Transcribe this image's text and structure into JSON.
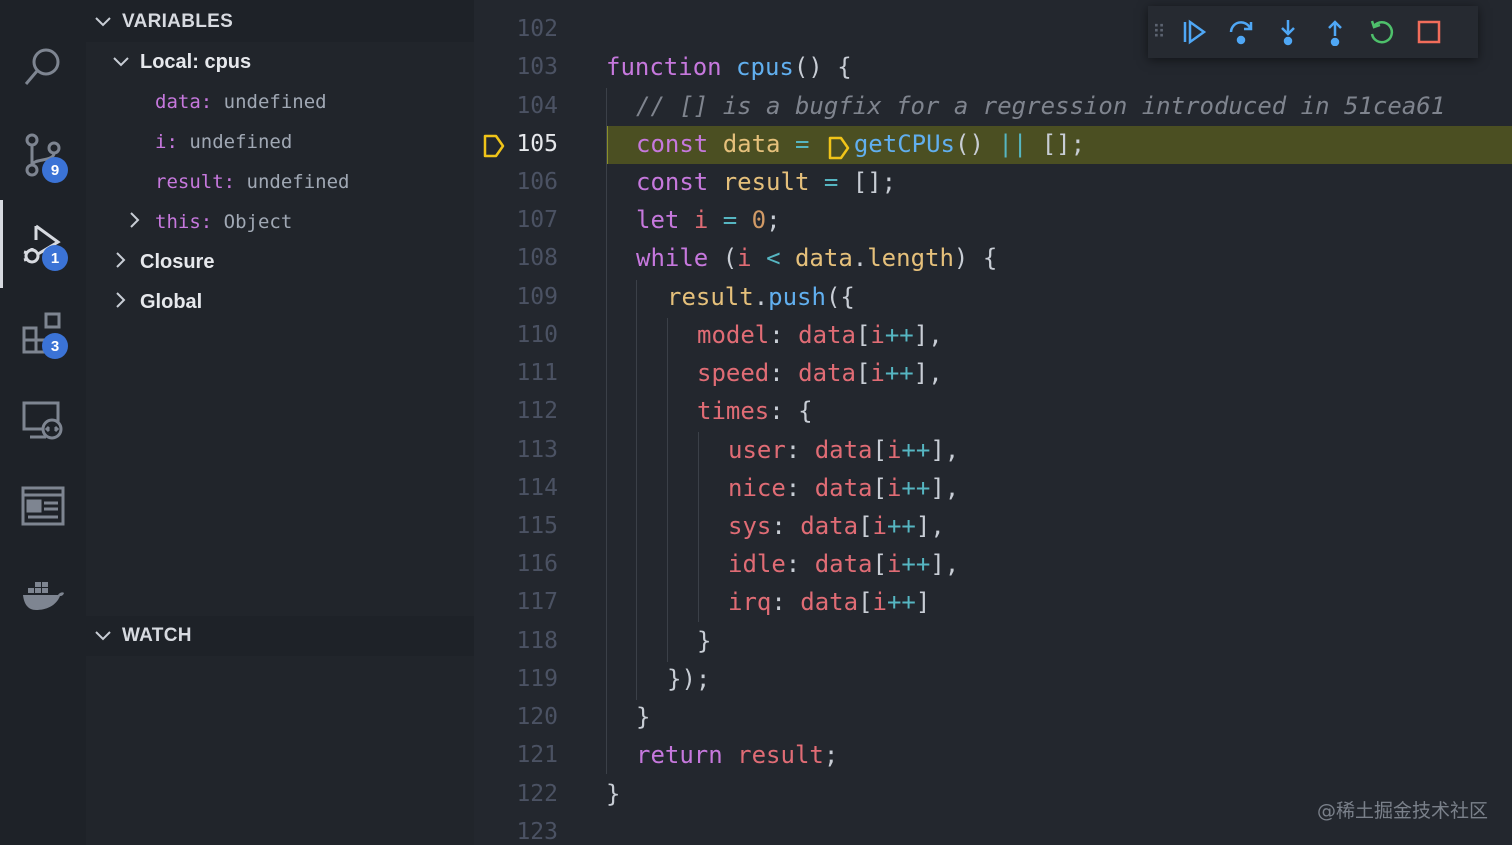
{
  "activity_bar": {
    "items": [
      {
        "icon": "search-icon"
      },
      {
        "icon": "source-control-icon",
        "badge": "9"
      },
      {
        "icon": "run-and-debug-icon",
        "badge": "1"
      },
      {
        "icon": "extensions-icon",
        "badge": "3"
      },
      {
        "icon": "remote-explorer-icon"
      },
      {
        "icon": "browser-preview-icon"
      },
      {
        "icon": "docker-icon"
      }
    ]
  },
  "sidebar": {
    "variables": {
      "title": "VARIABLES",
      "local_scope": "Local: cpus",
      "vars": [
        {
          "name": "data",
          "value": "undefined"
        },
        {
          "name": "i",
          "value": "undefined"
        },
        {
          "name": "result",
          "value": "undefined"
        },
        {
          "name": "this",
          "value": "Object"
        }
      ],
      "closure": "Closure",
      "global": "Global"
    },
    "watch": {
      "title": "WATCH"
    }
  },
  "editor": {
    "line_numbers": [
      "102",
      "103",
      "104",
      "105",
      "106",
      "107",
      "108",
      "109",
      "110",
      "111",
      "112",
      "113",
      "114",
      "115",
      "116",
      "117",
      "118",
      "119",
      "120",
      "121",
      "122",
      "123"
    ],
    "current_line": "105",
    "code": {
      "l103": [
        "function",
        "cpus",
        "() {"
      ],
      "l104": "// [] is a bugfix for a regression introduced in 51cea61",
      "l105": [
        "const",
        "data",
        "=",
        "getCPUs",
        "()",
        "||",
        "[];"
      ],
      "l106": [
        "const",
        "result",
        "=",
        "[];"
      ],
      "l107": [
        "let",
        "i",
        "=",
        "0",
        ";"
      ],
      "l108": [
        "while",
        "(",
        "i",
        "<",
        "data",
        ".",
        "length",
        ") {"
      ],
      "l109": [
        "result",
        ".",
        "push",
        "({"
      ],
      "l110": [
        "model",
        ": ",
        "data",
        "[",
        "i",
        "++",
        "],"
      ],
      "l111": [
        "speed",
        ": ",
        "data",
        "[",
        "i",
        "++",
        "],"
      ],
      "l112": [
        "times",
        ": {"
      ],
      "l113": [
        "user",
        ": ",
        "data",
        "[",
        "i",
        "++",
        "],"
      ],
      "l114": [
        "nice",
        ": ",
        "data",
        "[",
        "i",
        "++",
        "],"
      ],
      "l115": [
        "sys",
        ": ",
        "data",
        "[",
        "i",
        "++",
        "],"
      ],
      "l116": [
        "idle",
        ": ",
        "data",
        "[",
        "i",
        "++",
        "],"
      ],
      "l117": [
        "irq",
        ": ",
        "data",
        "[",
        "i",
        "++",
        "]"
      ],
      "l118": "}",
      "l119": "});",
      "l120": "}",
      "l121": [
        "return",
        "result",
        ";"
      ],
      "l122": "}"
    }
  },
  "debug_toolbar": {
    "buttons": [
      "continue-icon",
      "step-over-icon",
      "step-into-icon",
      "step-out-icon",
      "restart-icon",
      "stop-icon"
    ],
    "colors": {
      "continue": "#4fa7f5",
      "restart": "#4ec06b",
      "stop": "#f16d5b"
    }
  },
  "watermark": "@稀土掘金技术社区",
  "colors": {
    "keyword": "#c678dd",
    "function": "#61afef",
    "variable": "#e06c75",
    "property": "#e5c07b",
    "highlight": "#4b4f22",
    "badge": "#3b73d6"
  }
}
